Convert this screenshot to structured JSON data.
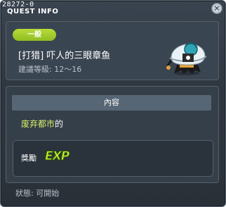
{
  "window": {
    "quest_id": "28272-0",
    "title": "QUEST INFO",
    "close_icon": "close-icon"
  },
  "header": {
    "category": "一般",
    "quest_name": "[打猎] 吓人的三眼章鱼",
    "level_text": "建議等級: 12～16"
  },
  "content": {
    "section_title": "內容",
    "location": "废弃都市",
    "suffix": "的"
  },
  "reward": {
    "label": "獎勵",
    "exp_icon": "EXP"
  },
  "status": {
    "text": "狀態: 可開始"
  },
  "colors": {
    "badge_green": "#a6d02e",
    "highlight_yellow": "#d6ec6a"
  }
}
